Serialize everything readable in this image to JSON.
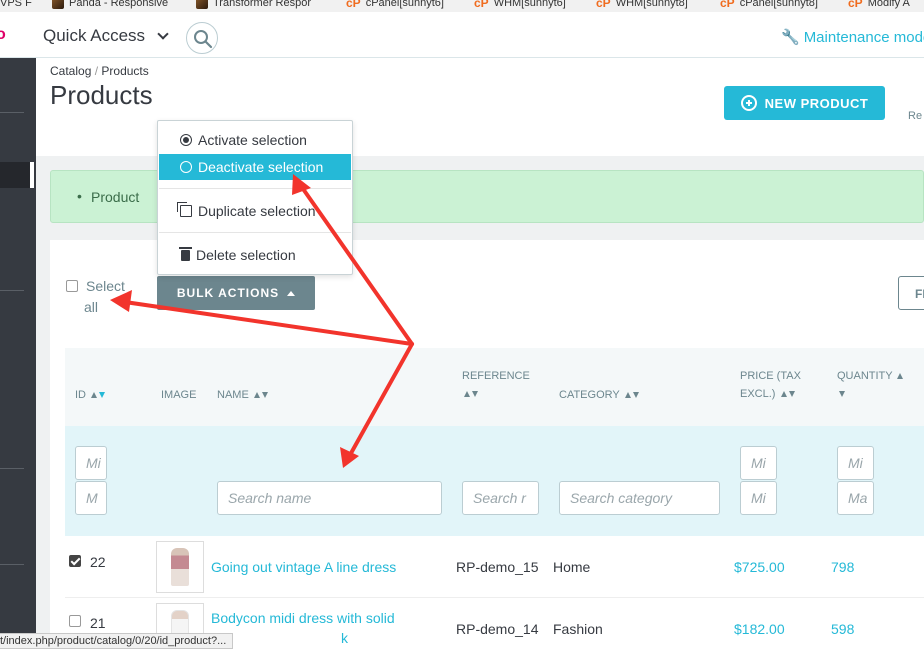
{
  "bookmarks": [
    {
      "label": "VPS F",
      "icon": "none"
    },
    {
      "label": "Panda - Responsive",
      "icon": "thumbnail"
    },
    {
      "label": "Transformer Respor",
      "icon": "thumbnail"
    },
    {
      "label": "cPanel[sunnyt6]",
      "icon": "cpanel"
    },
    {
      "label": "WHM[sunnyt6]",
      "icon": "cpanel"
    },
    {
      "label": "WHM[sunnyt8]",
      "icon": "cpanel"
    },
    {
      "label": "cPanel[sunnyt8]",
      "icon": "cpanel"
    },
    {
      "label": "Modify A",
      "icon": "cpanel"
    }
  ],
  "header": {
    "logo_fragment": "o",
    "quick_access": "Quick Access",
    "maintenance": "Maintenance mode"
  },
  "breadcrumb": {
    "parent": "Catalog",
    "separator": "/",
    "current": "Products"
  },
  "page_title": "Products",
  "new_product": "NEW PRODUCT",
  "header_fragment": "Re",
  "alert_text": "Product",
  "bulk": {
    "select_all_1": "Select",
    "select_all_2": "all",
    "button": "BULK ACTIONS",
    "menu": [
      {
        "label": "Activate selection",
        "icon": "radio-checked-icon"
      },
      {
        "label": "Deactivate selection",
        "icon": "radio-unchecked-icon"
      },
      {
        "label": "Duplicate selection",
        "icon": "copy-icon"
      },
      {
        "label": "Delete selection",
        "icon": "trash-icon"
      }
    ]
  },
  "filter_button": "FI",
  "columns": {
    "id": "ID",
    "image": "IMAGE",
    "name": "NAME",
    "reference": "REFERENCE",
    "category": "CATEGORY",
    "price_1": "PRICE (TAX",
    "price_2": "EXCL.)",
    "quantity": "QUANTITY"
  },
  "filters": {
    "id_min": "Mi",
    "id_max": "M",
    "name": "Search name",
    "reference": "Search r",
    "category": "Search category",
    "price_min": "Mi",
    "price_max": "Mi",
    "qty_min": "Mi",
    "qty_max": "Ma"
  },
  "rows": [
    {
      "id": "22",
      "name": "Going out vintage A line dress",
      "reference": "RP-demo_15",
      "category": "Home",
      "price": "$725.00",
      "quantity": "798",
      "checked": true
    },
    {
      "id": "21",
      "name": "Bodycon midi dress with solid",
      "name_2": "k",
      "reference": "RP-demo_14",
      "category": "Fashion",
      "price": "$182.00",
      "quantity": "598",
      "checked": false
    }
  ],
  "status_url": "t/index.php/product/catalog/0/20/id_product?...",
  "colors": {
    "accent": "#25b9d7",
    "sidebar": "#363a41",
    "bulk_button": "#6c868e",
    "alert_bg": "#cbf2d4",
    "annotation_arrow": "#f2342c"
  }
}
